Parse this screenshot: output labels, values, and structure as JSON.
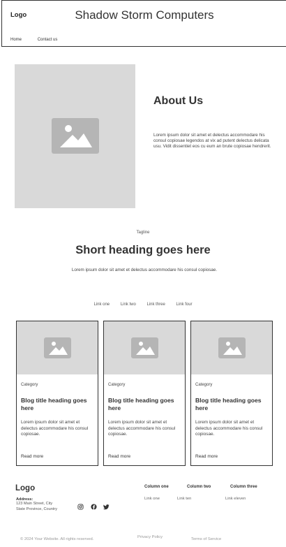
{
  "header": {
    "logo": "Logo",
    "title": "Shadow Storm Computers",
    "nav": [
      "Home",
      "Contact us"
    ]
  },
  "about": {
    "title": "About Us",
    "text": "Lorem ipsum dolor sit amet et delectus accommodare his consul copiosae legendos at vix ad putent delectus delicata usu. Vidit dissentiet eos cu eum an brute copiosae hendrerit."
  },
  "section": {
    "tagline": "Tagline",
    "heading": "Short heading goes here",
    "text": "Lorem ipsum dolor sit amet et delectus accommodare his consul copiosae."
  },
  "links": [
    "Link one",
    "Link two",
    "Link three",
    "Link four"
  ],
  "cards": [
    {
      "category": "Category",
      "title": "Blog title heading goes here",
      "description": "Lorem ipsum dolor sit amet et delectus accommodare his consul copiosae.",
      "link": "Read more"
    },
    {
      "category": "Category",
      "title": "Blog title heading goes here",
      "description": "Lorem ipsum dolor sit amet et delectus accommodare his consul copiosae.",
      "link": "Read more"
    },
    {
      "category": "Category",
      "title": "Blog title heading goes here",
      "description": "Lorem ipsum dolor sit amet et delectus accommodare his consul copiosae.",
      "link": "Read more"
    }
  ],
  "footer": {
    "logo": "Logo",
    "address_label": "Address:",
    "address_line1": "123 Main Street, City",
    "address_line2": "State Province, Country",
    "social_icons": [
      "instagram-icon",
      "facebook-icon",
      "twitter-icon"
    ],
    "columns": [
      {
        "heading": "Column one",
        "link": "Link one"
      },
      {
        "heading": "Column two",
        "link": "Link ten"
      },
      {
        "heading": "Column three",
        "link": "Link eleven"
      }
    ],
    "copyright": "© 2024 Your Website. All rights reserved.",
    "privacy": "Privacy Policy",
    "terms": "Terms of Service"
  },
  "colors": {
    "placeholder_bg": "#d9d9d9",
    "placeholder_icon": "#b5b5b5",
    "text": "#333333"
  }
}
